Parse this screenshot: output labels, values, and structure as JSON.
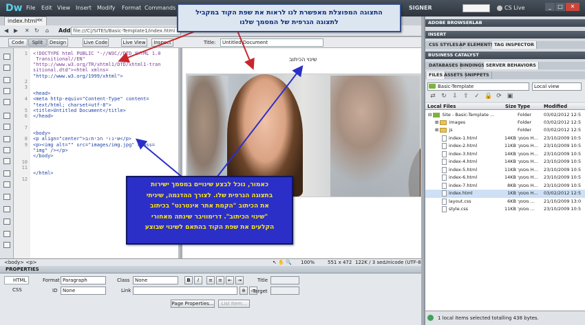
{
  "app": {
    "logo": "Dw",
    "menu": [
      "File",
      "Edit",
      "View",
      "Insert",
      "Modify",
      "Format",
      "Commands"
    ],
    "workspace": "SIGNER",
    "cs_live": "CS Live",
    "window_buttons": [
      "_",
      "□",
      "✕"
    ]
  },
  "document": {
    "tab_name": "index.html*",
    "address_label": "Address:",
    "address_value": "file:///C|/SITES/Basic-Template1/index.html",
    "views": [
      "Code",
      "Split",
      "Design",
      "Live Code",
      "Live View",
      "Inspect"
    ],
    "active_view": "Split",
    "title_label": "Title:",
    "title_value": "Untitled Document"
  },
  "code": {
    "line_numbers": [
      "1",
      "2",
      "3",
      "4",
      "5",
      "6",
      "7",
      "8",
      "9",
      "10",
      "11",
      "12"
    ],
    "lines": [
      "<!DOCTYPE html PUBLIC \"-//W3C//DTD XHTML 1.0",
      " Transitional//EN\"",
      "\"http://www.w3.org/TR/xhtml1/DTD/xhtml1-tran",
      "sitional.dtd\"><html xmlns=",
      "\"http://www.w3.org/1999/xhtml\">",
      "",
      "<head>",
      "<meta http-equiv=\"Content-Type\" content=",
      "\"text/html; charset=utf-8\">",
      "<title>Untitled Document</title>",
      "</head>",
      "",
      "<body>",
      "<p align=\"center\">שינוי הכיתוב</p>",
      "<p><img alt=\"\" src=\"images/img.jpg\" class=",
      "\"img\" /></p>",
      "</body>",
      "",
      "</html>"
    ]
  },
  "design": {
    "heading_text": "שינוי הכיתוב"
  },
  "status": {
    "tags": "<body> <p>",
    "zoom": "100%",
    "dimensions": "551 x 472",
    "size_time": "122K / 3 sec",
    "encoding": "Unicode (UTF-8"
  },
  "properties": {
    "header": "PROPERTIES",
    "html_tab": "HTML",
    "css_tab": "CSS",
    "format_label": "Format",
    "format_value": "Paragraph",
    "id_label": "ID",
    "id_value": "None",
    "class_label": "Class",
    "class_value": "None",
    "link_label": "Link",
    "bold": "B",
    "italic": "I",
    "title_label": "Title",
    "target_label": "Target",
    "page_properties": "Page Properties...",
    "list_item": "List Item..."
  },
  "panels": {
    "groups": [
      "ADOBE BROWSERLAB",
      "INSERT",
      "BUSINESS CATALYST"
    ],
    "tabs_row1": [
      "CSS STYLES",
      "AP ELEMENTS",
      "TAG INSPECTOR"
    ],
    "tabs_row2": [
      "DATABASES",
      "BINDINGS",
      "SERVER BEHAVIORS"
    ],
    "tabs_row3": [
      "FILES",
      "ASSETS",
      "SNIPPETS"
    ],
    "site": "Basic-Template",
    "view": "Local view",
    "columns": [
      "Local Files",
      "Size",
      "Type",
      "Modified"
    ],
    "files": [
      {
        "name": "Site - Basic-Template ...",
        "size": "",
        "type": "Folder",
        "modified": "03/02/2012 12:5"
      },
      {
        "name": "images",
        "size": "",
        "type": "Folder",
        "modified": "03/02/2012 12:5"
      },
      {
        "name": "js",
        "size": "",
        "type": "Folder",
        "modified": "03/02/2012 12:5"
      },
      {
        "name": "index-1.html",
        "size": "14KB",
        "type": "מסמך H...",
        "modified": "23/10/2009 10:5"
      },
      {
        "name": "index-2.html",
        "size": "11KB",
        "type": "מסמך H...",
        "modified": "23/10/2009 10:5"
      },
      {
        "name": "index-3.html",
        "size": "14KB",
        "type": "מסמך H...",
        "modified": "23/10/2009 10:5"
      },
      {
        "name": "index-4.html",
        "size": "14KB",
        "type": "מסמך H...",
        "modified": "23/10/2009 10:5"
      },
      {
        "name": "index-5.html",
        "size": "11KB",
        "type": "מסמך H...",
        "modified": "23/10/2009 10:5"
      },
      {
        "name": "index-6.html",
        "size": "14KB",
        "type": "מסמך H...",
        "modified": "23/10/2009 10:5"
      },
      {
        "name": "index-7.html",
        "size": "8KB",
        "type": "מסמך H...",
        "modified": "23/10/2009 10:5"
      },
      {
        "name": "index.html",
        "size": "1KB",
        "type": "מסמך H...",
        "modified": "03/02/2012 12:5"
      },
      {
        "name": "layout.css",
        "size": "6KB",
        "type": "מסמך ...",
        "modified": "21/10/2009 13:0"
      },
      {
        "name": "style.css",
        "size": "11KB",
        "type": "מסמך ...",
        "modified": "23/10/2009 10:5"
      }
    ],
    "status": "1 local items selected totalling 438 bytes."
  },
  "annotations": {
    "top_line1": "התצוגה המפוצלת מאפשרת לנו לראות את שפת הקוד במקביל",
    "top_line2": "לתצוגה הגרפית של המסמך שלנו",
    "bottom_line1": "כאמור, נוכל לבצע שינויים במסמך ישירות",
    "bottom_line2": "בתצוגה הגרפית שלו. לצורך ההדגמה, שיניתי",
    "bottom_line3": "את הכיתוב \"הקמת אתר אינטרנט\" בכיתוב",
    "bottom_line4": "\"שינוי הכיתוב\". דרימוויבר שינתה מאחורי",
    "bottom_line5": "הקלעים את שפת הקוד בהתאם לשינוי שבוצע"
  }
}
